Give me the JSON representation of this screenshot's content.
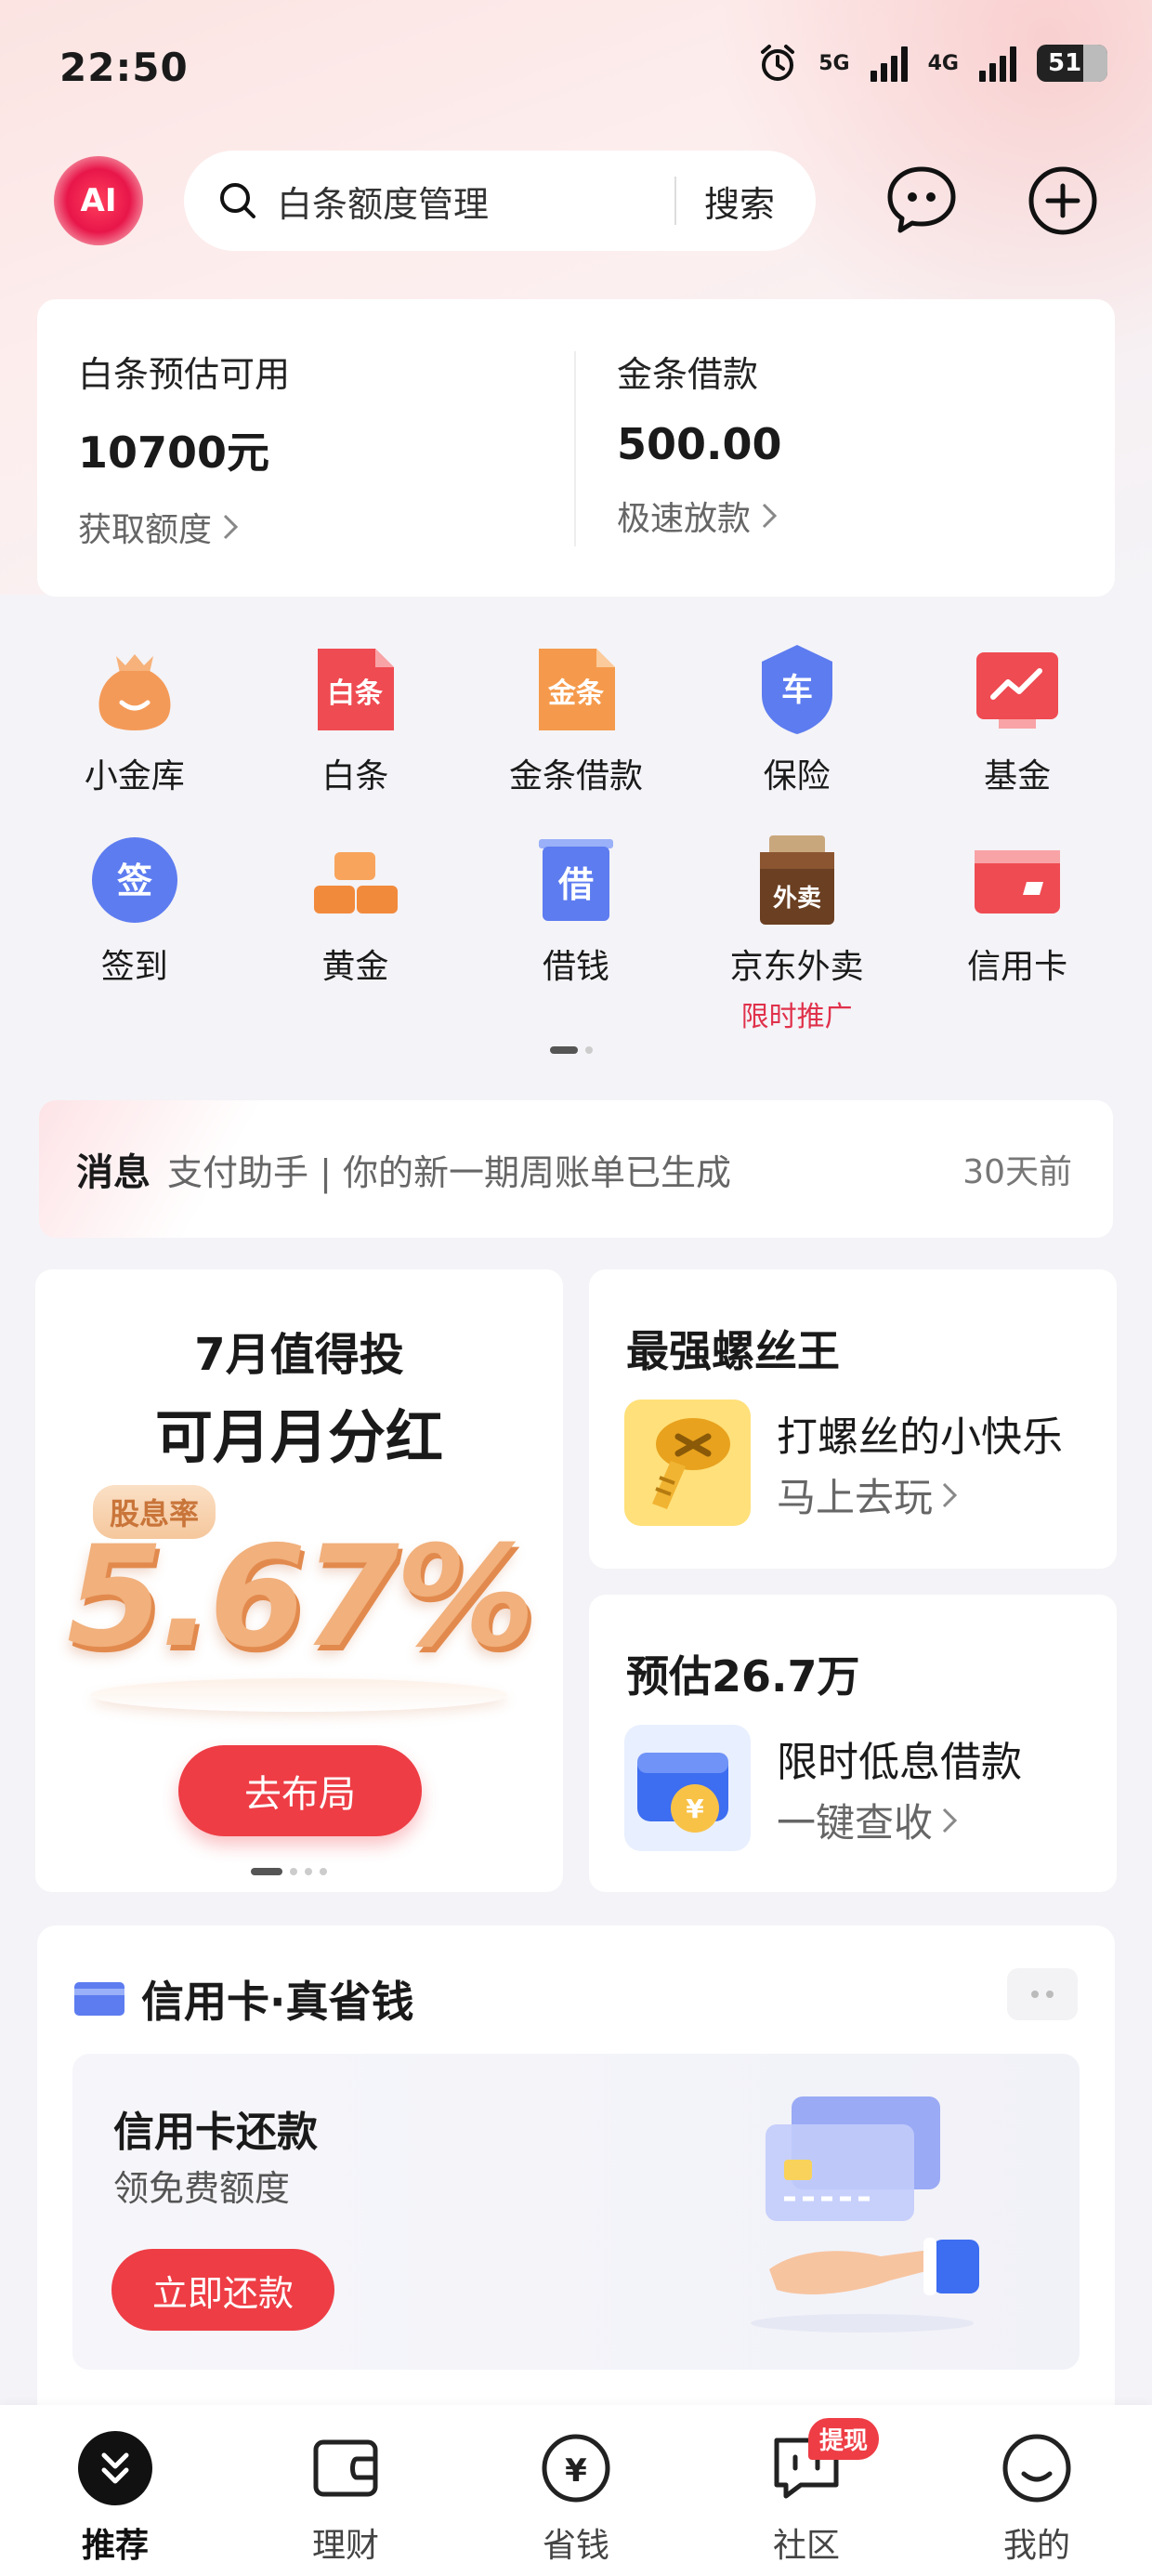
{
  "status_bar": {
    "time": "22:50",
    "net1": "5G",
    "net2": "4G",
    "battery": "51"
  },
  "header": {
    "ai_logo": "AI",
    "search_placeholder": "白条额度管理",
    "search_button": "搜索"
  },
  "balance": {
    "left": {
      "label": "白条预估可用",
      "value": "10700元",
      "link": "获取额度"
    },
    "right": {
      "label": "金条借款",
      "value": "500.00",
      "link": "极速放款"
    }
  },
  "grid": {
    "row1": [
      {
        "label": "小金库",
        "icon": "money-bag-icon"
      },
      {
        "label": "白条",
        "icon": "baitiao-icon",
        "glyph": "白条"
      },
      {
        "label": "金条借款",
        "icon": "jintiao-icon",
        "glyph": "金条"
      },
      {
        "label": "保险",
        "icon": "insurance-shield-icon",
        "glyph": "车"
      },
      {
        "label": "基金",
        "icon": "fund-chart-icon"
      }
    ],
    "row2": [
      {
        "label": "签到",
        "icon": "checkin-icon",
        "glyph": "签"
      },
      {
        "label": "黄金",
        "icon": "gold-bars-icon"
      },
      {
        "label": "借钱",
        "icon": "borrow-icon",
        "glyph": "借"
      },
      {
        "label": "京东外卖",
        "icon": "takeout-bag-icon",
        "glyph": "外卖",
        "sub": "限时推广"
      },
      {
        "label": "信用卡",
        "icon": "credit-card-icon"
      }
    ]
  },
  "message": {
    "title": "消息",
    "text": "支付助手 | 你的新一期周账单已生成",
    "time": "30天前"
  },
  "invest_card": {
    "line1": "7月值得投",
    "line2": "可月月分红",
    "badge": "股息率",
    "rate": "5.67%",
    "button": "去布局"
  },
  "game_card": {
    "title": "最强螺丝王",
    "main": "打螺丝的小快乐",
    "sub": "马上去玩"
  },
  "loan_card": {
    "title": "预估26.7万",
    "main": "限时低息借款",
    "sub": "一键查收"
  },
  "credit_section": {
    "title": "信用卡·真省钱",
    "inner_title": "信用卡还款",
    "inner_sub": "领免费额度",
    "button": "立即还款"
  },
  "tabbar": [
    {
      "label": "推荐",
      "icon": "home-double-chevron-icon",
      "active": true
    },
    {
      "label": "理财",
      "icon": "wallet-icon"
    },
    {
      "label": "省钱",
      "icon": "save-money-icon"
    },
    {
      "label": "社区",
      "icon": "community-chat-icon",
      "badge": "提现"
    },
    {
      "label": "我的",
      "icon": "smiley-profile-icon"
    }
  ],
  "colors": {
    "accent": "#ee3d45",
    "promo_text": "#e0314b",
    "rate_orange": "#f1b07c"
  }
}
